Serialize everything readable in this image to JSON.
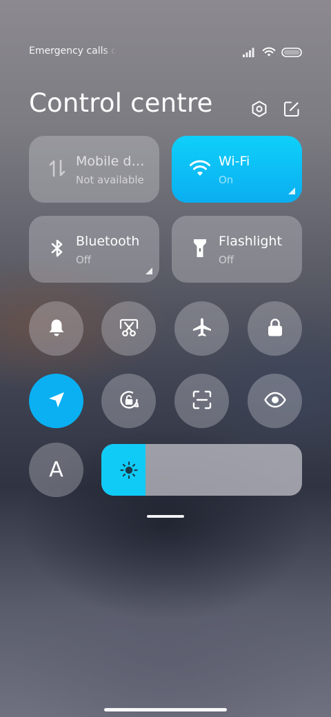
{
  "status_bar": {
    "carrier_text": "Emergency calls only",
    "icons": [
      "signal-icon",
      "wifi-icon",
      "battery-icon"
    ]
  },
  "header": {
    "title": "Control centre",
    "actions": [
      "settings-icon",
      "edit-icon"
    ]
  },
  "tiles": {
    "mobile_data": {
      "label": "Mobile data",
      "sublabel": "Not available",
      "state": "unavailable"
    },
    "wifi": {
      "label": "Wi-Fi",
      "sublabel": "On",
      "state": "on"
    },
    "bluetooth": {
      "label": "Bluetooth",
      "sublabel": "Off",
      "state": "off"
    },
    "flashlight": {
      "label": "Flashlight",
      "sublabel": "Off",
      "state": "off"
    }
  },
  "toggles": [
    {
      "id": "sound",
      "icon": "bell-icon",
      "active": false
    },
    {
      "id": "screenshot",
      "icon": "screenshot-icon",
      "active": false
    },
    {
      "id": "airplane",
      "icon": "airplane-icon",
      "active": false
    },
    {
      "id": "lock",
      "icon": "lock-icon",
      "active": false
    },
    {
      "id": "location",
      "icon": "location-arrow-icon",
      "active": true
    },
    {
      "id": "rotation-lock",
      "icon": "rotation-lock-icon",
      "active": false
    },
    {
      "id": "scanner",
      "icon": "scan-icon",
      "active": false
    },
    {
      "id": "reading-mode",
      "icon": "eye-icon",
      "active": false
    },
    {
      "id": "auto-brightness",
      "icon": "auto-brightness-icon",
      "glyph": "A",
      "active": false
    }
  ],
  "brightness": {
    "level": 0.22,
    "icon": "sun-icon"
  },
  "colors": {
    "accent": "#0ab0f2",
    "accent_light": "#10cbf6",
    "tile_inactive": "rgba(200,200,206,0.38)"
  }
}
